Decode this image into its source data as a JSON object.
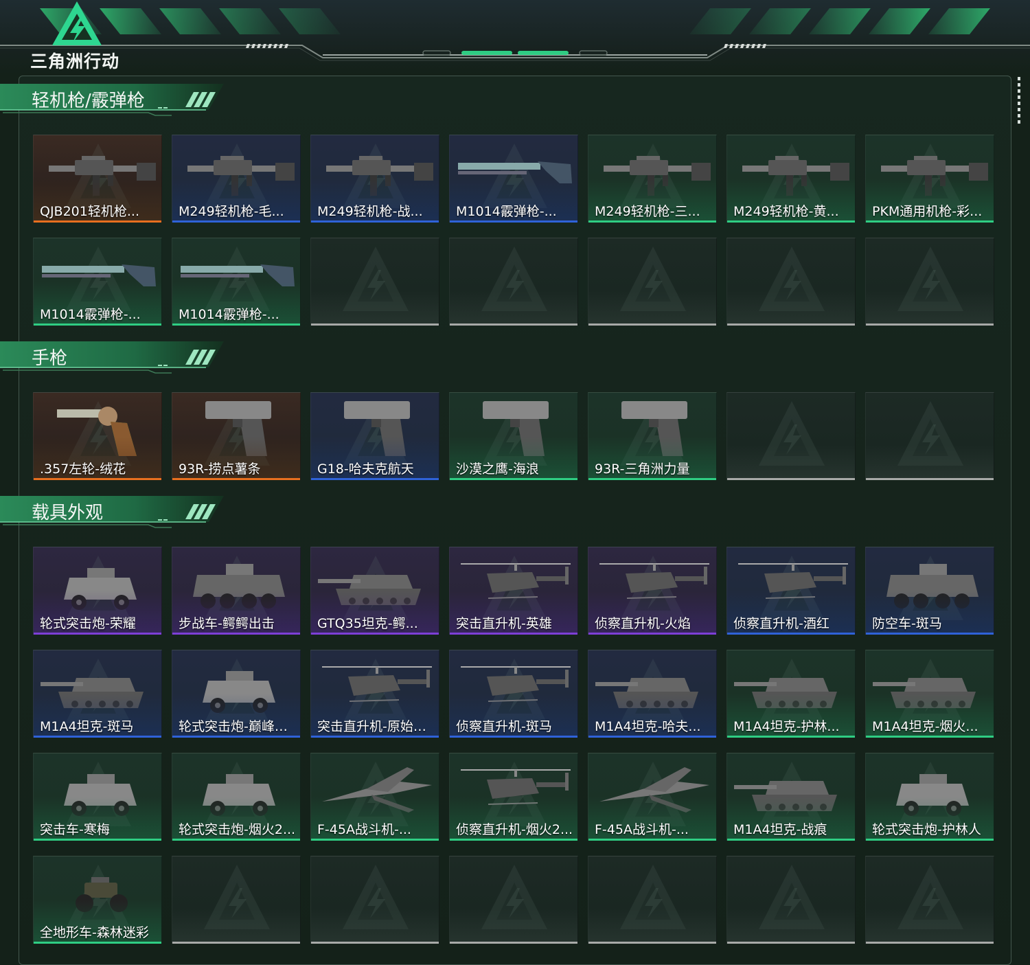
{
  "header": {
    "logo_text": "三角洲行动"
  },
  "colors": {
    "background": "#142119",
    "accent_green": "#2fcd83",
    "rarity_orange": "#e86f1f",
    "rarity_blue": "#2f62d8",
    "rarity_purple": "#7d3fd6",
    "empty_slot": "#a8aaa8"
  },
  "sections": [
    {
      "title": "轻机枪/霰弹枪",
      "items": [
        {
          "label": "QJB201轻机枪...",
          "rarity": "orange",
          "icon": "machine-gun-icon"
        },
        {
          "label": "M249轻机枪-毛...",
          "rarity": "blue",
          "icon": "machine-gun-icon"
        },
        {
          "label": "M249轻机枪-战...",
          "rarity": "blue",
          "icon": "machine-gun-icon"
        },
        {
          "label": "M1014霰弹枪-...",
          "rarity": "blue",
          "icon": "shotgun-icon"
        },
        {
          "label": "M249轻机枪-三...",
          "rarity": "green",
          "icon": "machine-gun-icon"
        },
        {
          "label": "M249轻机枪-黄...",
          "rarity": "green",
          "icon": "machine-gun-icon"
        },
        {
          "label": "PKM通用机枪-彩...",
          "rarity": "green",
          "icon": "machine-gun-icon"
        },
        {
          "label": "M1014霰弹枪-...",
          "rarity": "green",
          "icon": "shotgun-icon"
        },
        {
          "label": "M1014霰弹枪-...",
          "rarity": "green",
          "icon": "shotgun-icon"
        },
        null,
        null,
        null,
        null,
        null
      ]
    },
    {
      "title": "手枪",
      "items": [
        {
          "label": ".357左轮-绒花",
          "rarity": "orange",
          "icon": "revolver-icon"
        },
        {
          "label": "93R-捞点薯条",
          "rarity": "orange",
          "icon": "pistol-icon"
        },
        {
          "label": "G18-哈夫克航天",
          "rarity": "blue",
          "icon": "pistol-icon"
        },
        {
          "label": "沙漠之鹰-海浪",
          "rarity": "green",
          "icon": "pistol-icon"
        },
        {
          "label": "93R-三角洲力量",
          "rarity": "green",
          "icon": "pistol-icon"
        },
        null,
        null
      ]
    },
    {
      "title": "载具外观",
      "items": [
        {
          "label": "轮式突击炮-荣耀",
          "rarity": "purple",
          "icon": "armored-car-icon"
        },
        {
          "label": "步战车-鳄鳄出击",
          "rarity": "purple",
          "icon": "ifv-icon"
        },
        {
          "label": "GTQ35坦克-鳄...",
          "rarity": "purple",
          "icon": "tank-icon"
        },
        {
          "label": "突击直升机-英雄",
          "rarity": "purple",
          "icon": "helicopter-icon"
        },
        {
          "label": "侦察直升机-火焰",
          "rarity": "purple",
          "icon": "helicopter-icon"
        },
        {
          "label": "侦察直升机-酒红",
          "rarity": "blue",
          "icon": "helicopter-icon"
        },
        {
          "label": "防空车-斑马",
          "rarity": "blue",
          "icon": "ifv-icon"
        },
        {
          "label": "M1A4坦克-斑马",
          "rarity": "blue",
          "icon": "tank-icon"
        },
        {
          "label": "轮式突击炮-巅峰竞...",
          "rarity": "blue",
          "icon": "armored-car-icon"
        },
        {
          "label": "突击直升机-原始伪...",
          "rarity": "blue",
          "icon": "helicopter-icon"
        },
        {
          "label": "侦察直升机-斑马",
          "rarity": "blue",
          "icon": "helicopter-icon"
        },
        {
          "label": "M1A4坦克-哈夫...",
          "rarity": "blue",
          "icon": "tank-icon"
        },
        {
          "label": "M1A4坦克-护林...",
          "rarity": "green",
          "icon": "tank-icon"
        },
        {
          "label": "M1A4坦克-烟火...",
          "rarity": "green",
          "icon": "tank-icon"
        },
        {
          "label": "突击车-寒梅",
          "rarity": "green",
          "icon": "armored-car-icon"
        },
        {
          "label": "轮式突击炮-烟火2...",
          "rarity": "green",
          "icon": "armored-car-icon"
        },
        {
          "label": "F-45A战斗机-...",
          "rarity": "green",
          "icon": "fighter-jet-icon"
        },
        {
          "label": "侦察直升机-烟火2...",
          "rarity": "green",
          "icon": "helicopter-icon"
        },
        {
          "label": "F-45A战斗机-...",
          "rarity": "green",
          "icon": "fighter-jet-icon"
        },
        {
          "label": "M1A4坦克-战痕",
          "rarity": "green",
          "icon": "tank-icon"
        },
        {
          "label": "轮式突击炮-护林人",
          "rarity": "green",
          "icon": "armored-car-icon"
        },
        {
          "label": "全地形车-森林迷彩",
          "rarity": "green",
          "icon": "atv-icon"
        },
        null,
        null,
        null,
        null,
        null,
        null
      ]
    }
  ]
}
